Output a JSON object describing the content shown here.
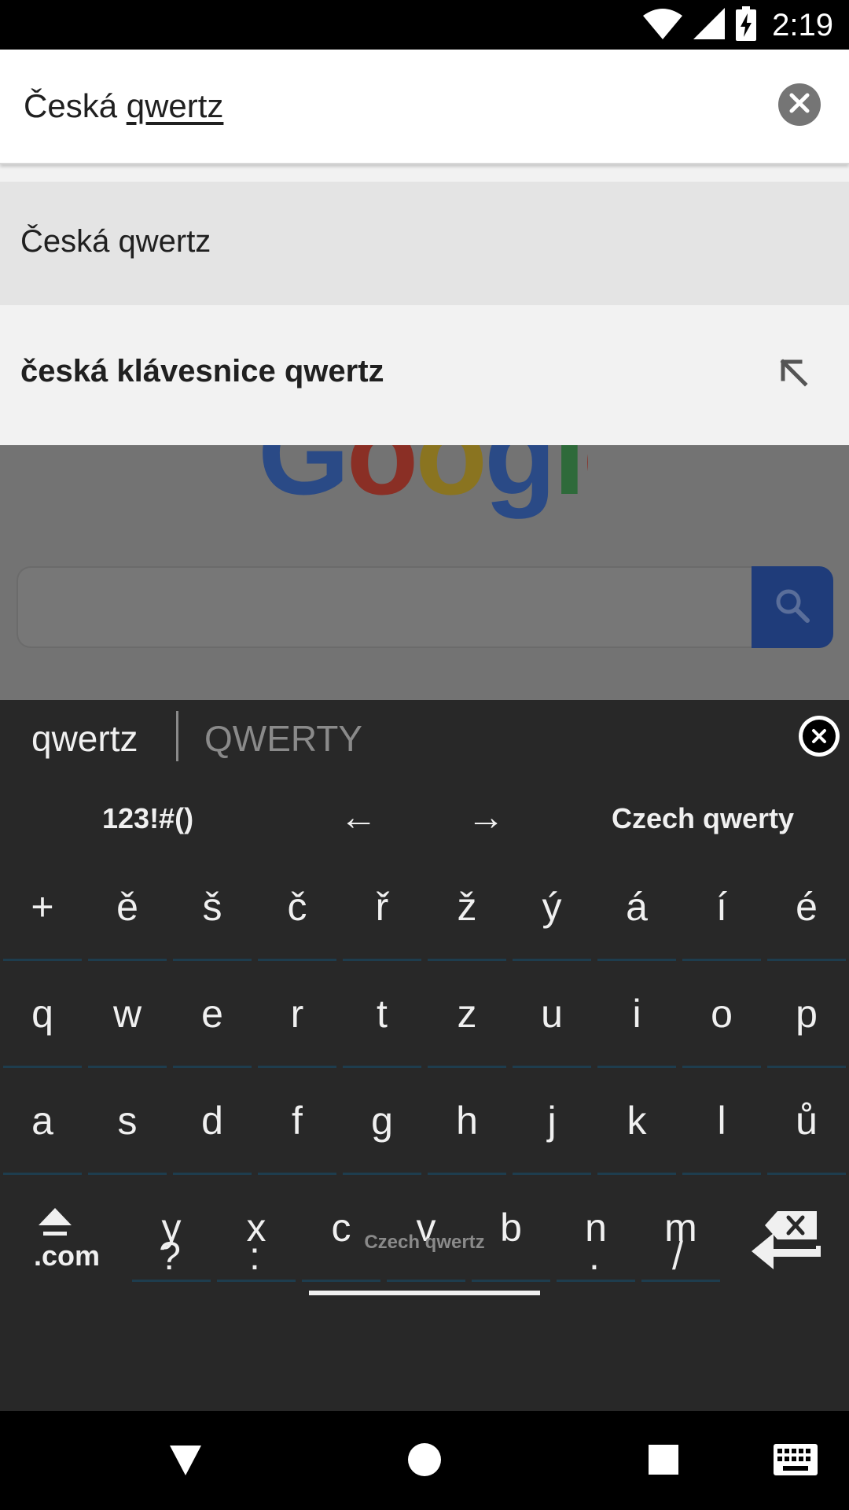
{
  "status_bar": {
    "time": "2:19",
    "icons": [
      "wifi-icon",
      "signal-icon",
      "battery-charging-icon"
    ]
  },
  "search": {
    "prefix": "Česká ",
    "composing": "qwertz"
  },
  "suggestions": [
    {
      "text": "Česká qwertz"
    },
    {
      "text": "česká klávesnice qwertz",
      "action_icon": "insert-arrow-icon"
    }
  ],
  "page": {
    "logo_text": "Google"
  },
  "keyboard": {
    "candidates": {
      "primary": "qwertz",
      "secondary": "QWERTY"
    },
    "tools": {
      "symbols": "123!#()",
      "left_arrow": "←",
      "right_arrow": "→",
      "layout_name": "Czech qwerty"
    },
    "rows": [
      [
        "+",
        "ě",
        "š",
        "č",
        "ř",
        "ž",
        "ý",
        "á",
        "í",
        "é"
      ],
      [
        "q",
        "w",
        "e",
        "r",
        "t",
        "z",
        "u",
        "i",
        "o",
        "p"
      ],
      [
        "a",
        "s",
        "d",
        "f",
        "g",
        "h",
        "j",
        "k",
        "l",
        "ů"
      ],
      [
        "y",
        "x",
        "c",
        "v",
        "b",
        "n",
        "m"
      ]
    ],
    "bottom": {
      "com": ".com",
      "question": "?",
      "colon": ":",
      "space_label": "Czech qwertz",
      "period": ".",
      "slash": "/"
    }
  },
  "nav": {
    "icons": [
      "back-icon",
      "home-icon",
      "recents-icon",
      "keyboard-switch-icon"
    ]
  }
}
